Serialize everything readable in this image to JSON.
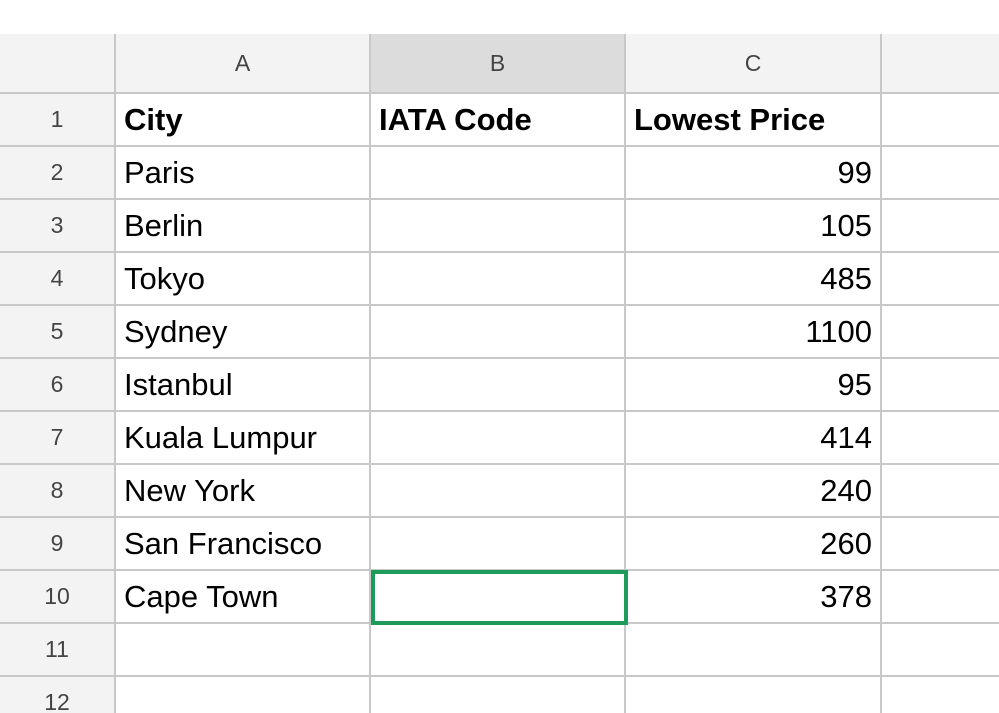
{
  "columns": {
    "a": "A",
    "b": "B",
    "c": "C",
    "d": ""
  },
  "selected_cell": "B10",
  "rows": [
    {
      "num": "1",
      "a": "City",
      "b": "IATA Code",
      "c": "Lowest Price"
    },
    {
      "num": "2",
      "a": "Paris",
      "b": "",
      "c": "99"
    },
    {
      "num": "3",
      "a": "Berlin",
      "b": "",
      "c": "105"
    },
    {
      "num": "4",
      "a": "Tokyo",
      "b": "",
      "c": "485"
    },
    {
      "num": "5",
      "a": "Sydney",
      "b": "",
      "c": "1100"
    },
    {
      "num": "6",
      "a": "Istanbul",
      "b": "",
      "c": "95"
    },
    {
      "num": "7",
      "a": "Kuala Lumpur",
      "b": "",
      "c": "414"
    },
    {
      "num": "8",
      "a": "New York",
      "b": "",
      "c": "240"
    },
    {
      "num": "9",
      "a": "San Francisco",
      "b": "",
      "c": "260"
    },
    {
      "num": "10",
      "a": "Cape Town",
      "b": "",
      "c": "378"
    },
    {
      "num": "11",
      "a": "",
      "b": "",
      "c": ""
    },
    {
      "num": "12",
      "a": "",
      "b": "",
      "c": ""
    }
  ],
  "colors": {
    "selection_border": "#1e9b5a",
    "header_bg": "#f3f3f3",
    "active_header_bg": "#dcdcdc",
    "grid_line": "#c8c8c8"
  }
}
